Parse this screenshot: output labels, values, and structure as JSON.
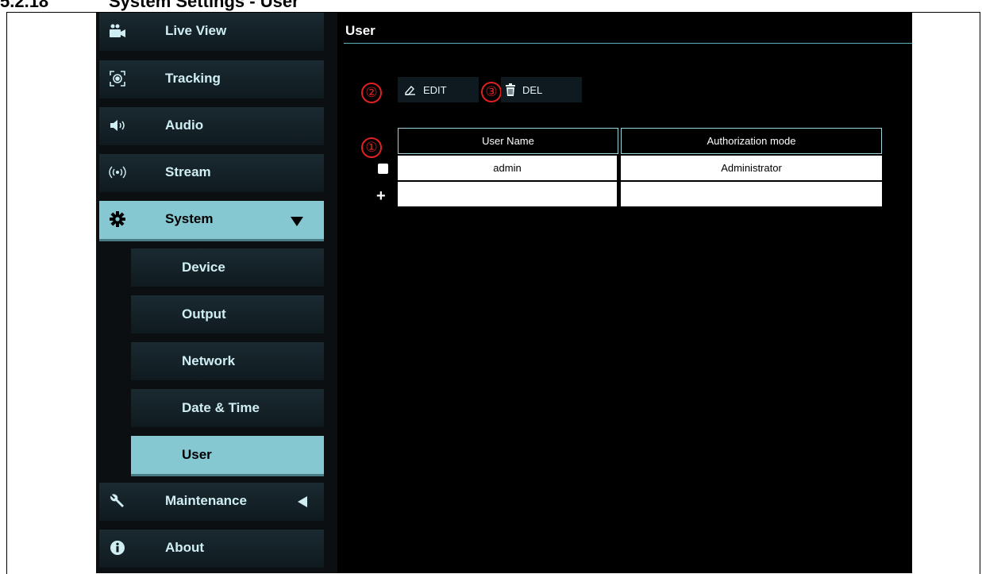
{
  "doc_heading": {
    "number": "5.2.18",
    "text": "System Settings - User"
  },
  "sidebar": {
    "items": [
      {
        "label": "Live View",
        "icon": "video-camera-icon"
      },
      {
        "label": "Tracking",
        "icon": "tracking-target-icon"
      },
      {
        "label": "Audio",
        "icon": "speaker-icon"
      },
      {
        "label": "Stream",
        "icon": "broadcast-icon"
      },
      {
        "label": "System",
        "icon": "gear-icon",
        "arrow": "▼",
        "expanded": true
      },
      {
        "label": "Maintenance",
        "icon": "wrench-icon",
        "arrow": "◀"
      },
      {
        "label": "About",
        "icon": "info-icon"
      }
    ],
    "system_sub": [
      "Device",
      "Output",
      "Network",
      "Date & Time",
      "User"
    ],
    "active_sub": "User"
  },
  "content": {
    "title": "User",
    "toolbar": {
      "edit_label": "EDIT",
      "delete_label": "DEL"
    },
    "callouts": {
      "table": "①",
      "edit": "②",
      "delete": "③"
    },
    "table": {
      "headers": [
        "User Name",
        "Authorization mode"
      ],
      "rows": [
        [
          "admin",
          "Administrator"
        ],
        [
          "",
          ""
        ]
      ],
      "add_symbol": "+"
    }
  },
  "colors": {
    "accent": "#86c8d2",
    "callout": "#e02020",
    "background": "#000000"
  }
}
